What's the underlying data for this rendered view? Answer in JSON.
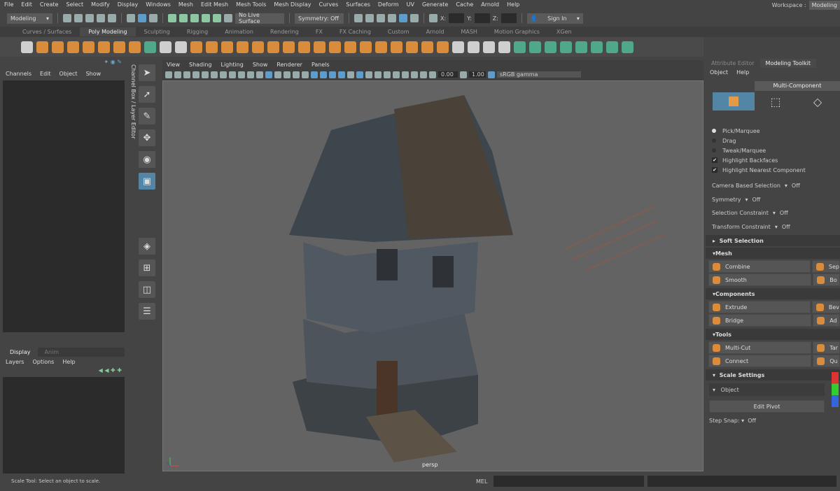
{
  "menu": [
    "File",
    "Edit",
    "Create",
    "Select",
    "Modify",
    "Display",
    "Windows",
    "Mesh",
    "Edit Mesh",
    "Mesh Tools",
    "Mesh Display",
    "Curves",
    "Surfaces",
    "Deform",
    "UV",
    "Generate",
    "Cache",
    "Arnold",
    "Help"
  ],
  "workspace": {
    "label": "Workspace :",
    "value": "Modeling"
  },
  "status": {
    "mode": "Modeling",
    "live_surface": "No Live Surface",
    "symmetry": "Symmetry: Off",
    "x": "X:",
    "y": "Y:",
    "z": "Z:",
    "sign_in": "Sign In"
  },
  "shelf_tabs": [
    "Curves / Surfaces",
    "Poly Modeling",
    "Sculpting",
    "Rigging",
    "Animation",
    "Rendering",
    "FX",
    "FX Caching",
    "Custom",
    "Arnold",
    "MASH",
    "Motion Graphics",
    "XGen"
  ],
  "active_shelf_tab": "Poly Modeling",
  "channel_box": {
    "menu": [
      "Channels",
      "Edit",
      "Object",
      "Show"
    ],
    "vertical_tab": "Channel Box / Layer Editor"
  },
  "layer_editor": {
    "tabs": [
      "Display",
      "Anim"
    ],
    "menu": [
      "Layers",
      "Options",
      "Help"
    ]
  },
  "viewport": {
    "menu": [
      "View",
      "Shading",
      "Lighting",
      "Show",
      "Renderer",
      "Panels"
    ],
    "exposure": "0.00",
    "gamma": "1.00",
    "color_space": "sRGB gamma",
    "camera": "persp"
  },
  "toolkit": {
    "tabs": [
      "Attribute Editor",
      "Modeling Toolkit"
    ],
    "menu": [
      "Object",
      "Help"
    ],
    "mode": "Multi-Component",
    "pick": [
      "Pick/Marquee",
      "Drag",
      "Tweak/Marquee"
    ],
    "checks": [
      "Highlight Backfaces",
      "Highlight Nearest Component"
    ],
    "options": [
      {
        "label": "Camera Based Selection",
        "value": "Off"
      },
      {
        "label": "Symmetry",
        "value": "Off"
      },
      {
        "label": "Selection Constraint",
        "value": "Off"
      },
      {
        "label": "Transform Constraint",
        "value": "Off"
      }
    ],
    "soft_selection": "Soft Selection",
    "sections": [
      {
        "title": "Mesh",
        "buttons": [
          [
            "Combine",
            "Sep"
          ],
          [
            "Smooth",
            "Bo"
          ]
        ]
      },
      {
        "title": "Components",
        "buttons": [
          [
            "Extrude",
            "Bev"
          ],
          [
            "Bridge",
            "Ad"
          ]
        ]
      },
      {
        "title": "Tools",
        "buttons": [
          [
            "Multi-Cut",
            "Tar"
          ],
          [
            "Connect",
            "Qu"
          ]
        ]
      }
    ],
    "scale_settings": "Scale Settings",
    "space": "Object",
    "edit_pivot": "Edit Pivot",
    "step_snap": {
      "label": "Step Snap:",
      "value": "Off"
    }
  },
  "bottom": {
    "help": "Scale Tool: Select an object to scale.",
    "mel": "MEL"
  },
  "colors": {
    "accent": "#5285a6",
    "icon_orange": "#d98c3c"
  }
}
